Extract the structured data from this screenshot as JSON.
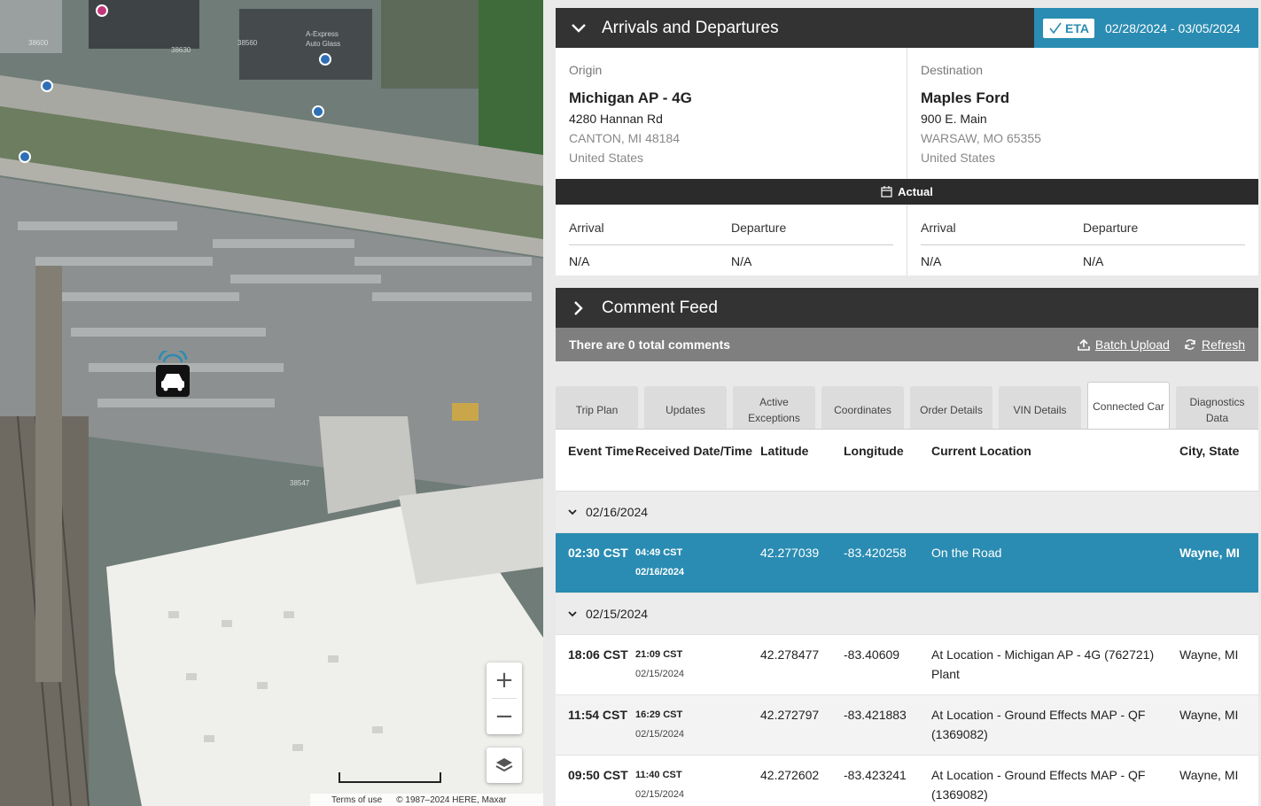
{
  "map": {
    "street_labels": [
      "38600",
      "38630",
      "38560",
      "A-Express",
      "Auto Glass",
      "38547"
    ],
    "zoom_in": "+",
    "zoom_out": "−",
    "scale_label": "200 ft",
    "terms": "Terms of use",
    "copyright": "© 1987–2024 HERE, Maxar"
  },
  "arrivals": {
    "title": "Arrivals and Departures",
    "eta_badge": "ETA",
    "eta_range": "02/28/2024 - 03/05/2024",
    "origin": {
      "kind": "Origin",
      "name": "Michigan AP - 4G",
      "street": "4280 Hannan Rd",
      "city": "CANTON, MI 48184",
      "country": "United States"
    },
    "destination": {
      "kind": "Destination",
      "name": "Maples Ford",
      "street": "900 E. Main",
      "city": "WARSAW, MO 65355",
      "country": "United States"
    },
    "actual_label": "Actual",
    "origin_times": {
      "arrival_label": "Arrival",
      "departure_label": "Departure",
      "arrival": "N/A",
      "departure": "N/A"
    },
    "destination_times": {
      "arrival_label": "Arrival",
      "departure_label": "Departure",
      "arrival": "N/A",
      "departure": "N/A"
    }
  },
  "comments": {
    "title": "Comment Feed",
    "count_text": "There are 0 total comments",
    "batch_upload": "Batch Upload",
    "refresh": "Refresh"
  },
  "tabs": [
    {
      "label": "Trip Plan"
    },
    {
      "label": "Updates"
    },
    {
      "label": "Active Exceptions"
    },
    {
      "label": "Coordinates"
    },
    {
      "label": "Order Details"
    },
    {
      "label": "VIN Details"
    },
    {
      "label": "Connected Car"
    },
    {
      "label": "Diagnostics Data"
    }
  ],
  "active_tab": "Connected Car",
  "table": {
    "headers": {
      "event_time": "Event Time",
      "received": "Received Date/Time",
      "latitude": "Latitude",
      "longitude": "Longitude",
      "location": "Current Location",
      "city": "City, State"
    },
    "groups": [
      {
        "date": "02/16/2024",
        "rows": [
          {
            "event_time": "02:30 CST",
            "received_time": "04:49",
            "received_tz": "CST",
            "received_date": "02/16/2024",
            "latitude": "42.277039",
            "longitude": "-83.420258",
            "location": "On the Road",
            "city": "Wayne, MI",
            "selected": true
          }
        ]
      },
      {
        "date": "02/15/2024",
        "rows": [
          {
            "event_time": "18:06 CST",
            "received_time": "21:09",
            "received_tz": "CST",
            "received_date": "02/15/2024",
            "latitude": "42.278477",
            "longitude": "-83.40609",
            "location": "At Location - Michigan AP - 4G (762721) Plant",
            "city": "Wayne, MI",
            "selected": false
          },
          {
            "event_time": "11:54 CST",
            "received_time": "16:29",
            "received_tz": "CST",
            "received_date": "02/15/2024",
            "latitude": "42.272797",
            "longitude": "-83.421883",
            "location": "At Location - Ground Effects MAP - QF (1369082)",
            "city": "Wayne, MI",
            "selected": false
          },
          {
            "event_time": "09:50 CST",
            "received_time": "11:40",
            "received_tz": "CST",
            "received_date": "02/15/2024",
            "latitude": "42.272602",
            "longitude": "-83.423241",
            "location": "At Location - Ground Effects MAP - QF (1369082)",
            "city": "Wayne, MI",
            "selected": false
          }
        ]
      }
    ]
  },
  "colors": {
    "accent": "#2a8cb2",
    "header_dark": "#333333",
    "comment_bar": "#7f7f7f"
  },
  "icons": [
    "chevron-down-icon",
    "chevron-right-icon",
    "eta-check-icon",
    "calendar-icon",
    "upload-icon",
    "refresh-icon",
    "zoom-in-icon",
    "zoom-out-icon",
    "layers-icon",
    "vehicle-marker-icon",
    "bus-stop-icon"
  ]
}
